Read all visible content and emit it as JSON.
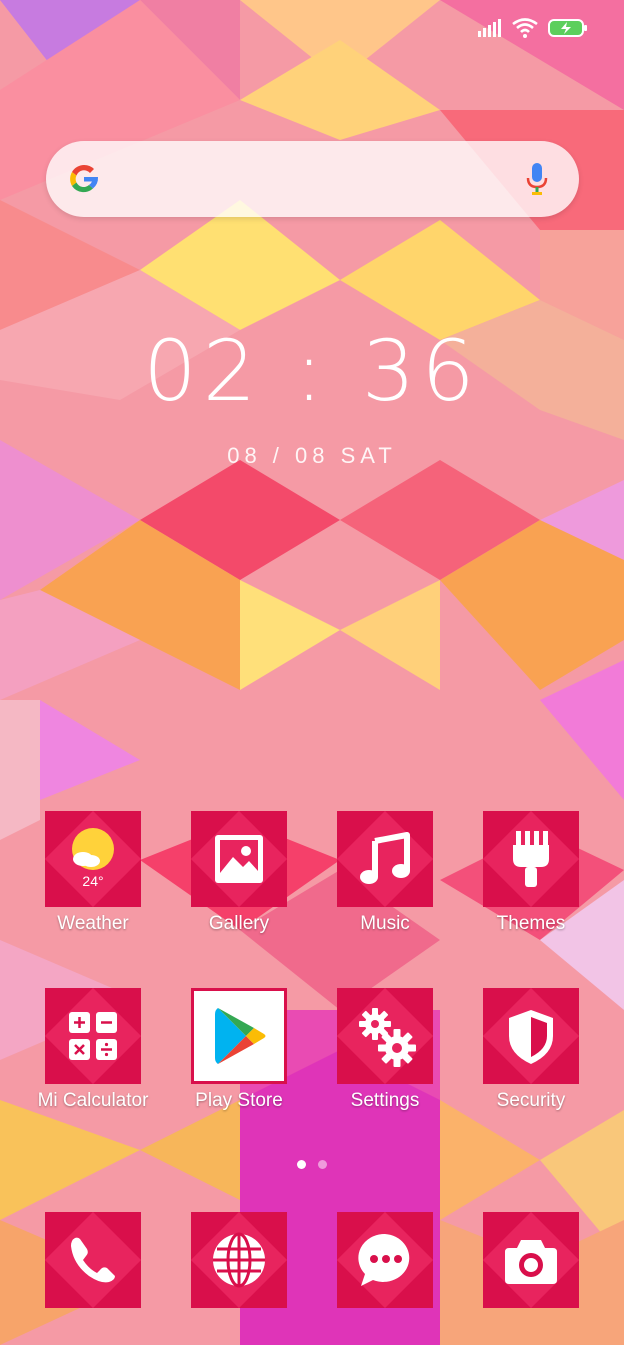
{
  "clock": {
    "time": "02 : 36",
    "date": "08 / 08  SAT"
  },
  "search": {
    "logo": "google-icon",
    "mic": "mic-icon"
  },
  "status_bar": {
    "icons": [
      "signal-icon",
      "wifi-icon",
      "battery-charging-icon"
    ]
  },
  "weather": {
    "temperature": "24°"
  },
  "apps_row1": [
    {
      "label": "Weather",
      "icon": "weather-icon"
    },
    {
      "label": "Gallery",
      "icon": "gallery-icon"
    },
    {
      "label": "Music",
      "icon": "music-icon"
    },
    {
      "label": "Themes",
      "icon": "themes-icon"
    }
  ],
  "apps_row2": [
    {
      "label": "Mi Calculator",
      "icon": "calculator-icon"
    },
    {
      "label": "Play Store",
      "icon": "play-store-icon"
    },
    {
      "label": "Settings",
      "icon": "settings-icon"
    },
    {
      "label": "Security",
      "icon": "security-icon"
    }
  ],
  "dock": [
    {
      "icon": "phone-icon"
    },
    {
      "icon": "browser-icon"
    },
    {
      "icon": "messages-icon"
    },
    {
      "icon": "camera-icon"
    }
  ],
  "page_indicator": {
    "count": 2,
    "active": 1
  },
  "colors": {
    "tile": "#d90f4b",
    "tile_diamond": "#e8245e",
    "battery": "#5ccf5c"
  }
}
